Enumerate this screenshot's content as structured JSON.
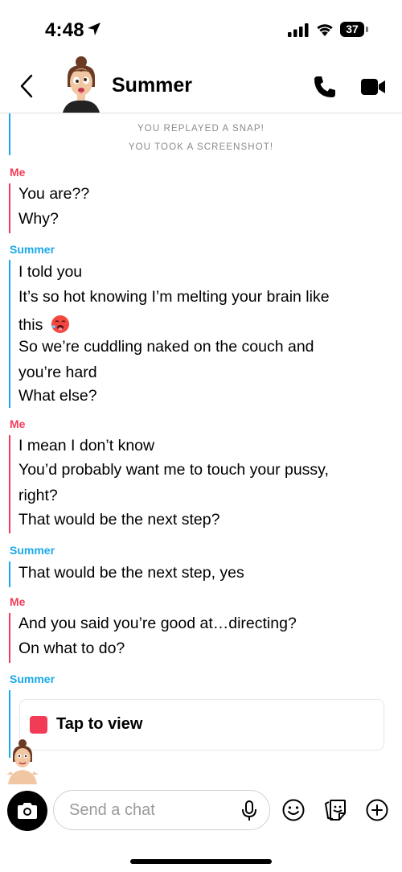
{
  "status_bar": {
    "time": "4:48",
    "battery": "37"
  },
  "header": {
    "contact_name": "Summer"
  },
  "chat": {
    "system_notes": [
      "YOU REPLAYED A SNAP!",
      "YOU TOOK A SCREENSHOT!"
    ],
    "groups": [
      {
        "sender": "Me",
        "lines": [
          "You are??",
          "Why?"
        ]
      },
      {
        "sender": "Summer",
        "lines": [
          "I told you",
          "It’s so hot knowing I’m melting your brain like",
          "this",
          "So we’re cuddling naked on the couch and",
          "you’re hard",
          "What else?"
        ]
      },
      {
        "sender": "Me",
        "lines": [
          "I mean I don’t know",
          "You’d probably want me to touch your pussy,",
          "right?",
          "That would be the next step?"
        ]
      },
      {
        "sender": "Summer",
        "lines": [
          "That would be the next step, yes"
        ]
      },
      {
        "sender": "Me",
        "lines": [
          "And you said you’re good at…directing?",
          "On what to do?"
        ]
      },
      {
        "sender": "Summer",
        "lines": []
      }
    ],
    "snap": {
      "label": "Tap to view",
      "color": "#f23c57"
    }
  },
  "input": {
    "placeholder": "Send a chat"
  },
  "colors": {
    "me": "#f23c57",
    "summer": "#1aa8e8"
  },
  "icons": [
    "back-chevron-icon",
    "phone-icon",
    "video-camera-icon",
    "camera-icon",
    "microphone-icon",
    "smiley-icon",
    "sticker-icon",
    "plus-circle-icon"
  ]
}
